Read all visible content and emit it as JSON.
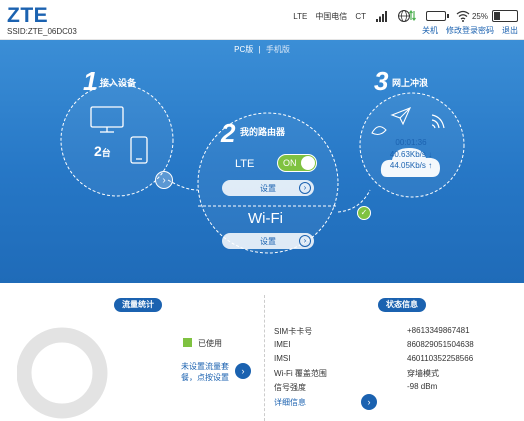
{
  "header": {
    "logo": "ZTE",
    "ssid": "SSID:ZTE_06DC03",
    "network_type": "LTE",
    "carrier": "中国电信",
    "carrier_code": "CT",
    "battery_percent": "25%",
    "links": {
      "shutdown": "关机",
      "change_password": "修改登录密码",
      "logout": "退出"
    }
  },
  "hero": {
    "version_pc": "PC版",
    "version_sep": "|",
    "version_mobile": "手机版",
    "step1": {
      "num": "1",
      "label": "接入设备",
      "count": "2",
      "count_unit": "台"
    },
    "step2": {
      "num": "2",
      "label": "我的路由器",
      "lte_label": "LTE",
      "toggle_text": "ON",
      "settings_btn": "设置",
      "wifi_label": "Wi-Fi",
      "wifi_settings_btn": "设置"
    },
    "step3": {
      "num": "3",
      "label": "网上冲浪",
      "duration": "00:01:36",
      "upload": "40.63Kb/s ↓",
      "download": "44.05Kb/s ↑"
    }
  },
  "bottom": {
    "traffic_title": "流量统计",
    "legend_used": "已使用",
    "traffic_link": "未设置流量套餐，点按设置",
    "status_title": "状态信息",
    "info": [
      {
        "label": "SIM卡卡号",
        "value": "+8613349867481"
      },
      {
        "label": "IMEI",
        "value": "860829051504638"
      },
      {
        "label": "IMSI",
        "value": "460110352258566"
      },
      {
        "label": "Wi-Fi 覆盖范围",
        "value": "穿墙模式"
      },
      {
        "label": "信号强度",
        "value": "-98 dBm"
      }
    ],
    "detail_link": "详细信息"
  },
  "colors": {
    "brand": "#1b62b0",
    "hero_bg": "#2677c6",
    "accent_green": "#7fc241"
  }
}
